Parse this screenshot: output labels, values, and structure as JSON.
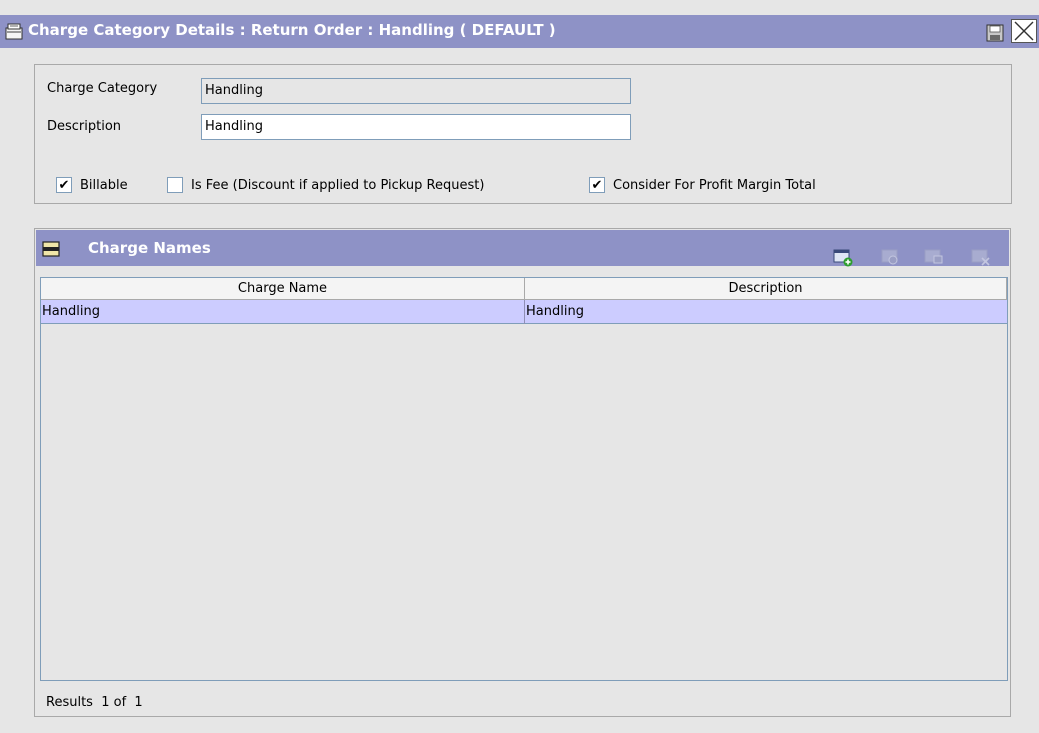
{
  "window": {
    "title": "Charge Category Details : Return Order : Handling ( DEFAULT )"
  },
  "details": {
    "charge_category_label": "Charge Category",
    "charge_category_value": "Handling",
    "description_label": "Description",
    "description_value": "Handling",
    "checkboxes": [
      {
        "label": "Billable",
        "checked": true
      },
      {
        "label": "Is Fee (Discount if applied to Pickup Request)",
        "checked": false
      },
      {
        "label": "Consider For Profit Margin Total",
        "checked": true
      }
    ]
  },
  "charges": {
    "title": "Charge Names",
    "columns": [
      "Charge Name",
      "Description"
    ],
    "rows": [
      {
        "charge_name": "Handling",
        "description": "Handling"
      }
    ],
    "results_text": "Results  1 of  1"
  },
  "colors": {
    "header_bar": "#8e92c6",
    "selected_row": "#ccccff",
    "panel_bg": "#e6e6e6"
  },
  "icons": {
    "title": "folder-open-icon",
    "save": "save-icon",
    "close": "close-icon",
    "collapse": "panel-collapse-icon",
    "tools": [
      "add-icon",
      "view-details-icon",
      "edit-icon",
      "delete-icon"
    ]
  }
}
